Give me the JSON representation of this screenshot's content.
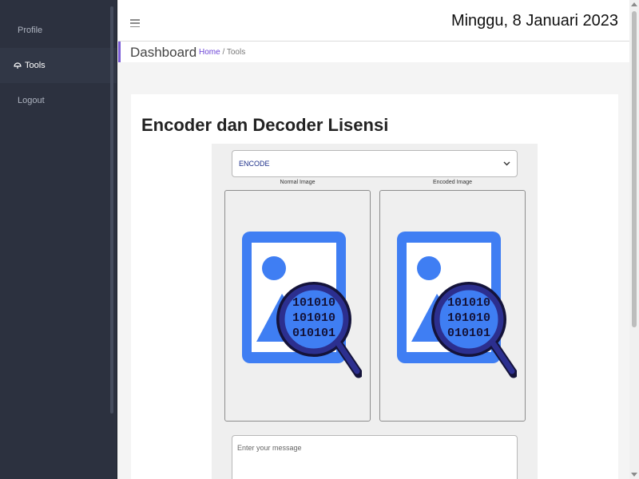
{
  "sidebar": {
    "items": [
      {
        "label": "Profile",
        "active": false
      },
      {
        "label": "Tools",
        "active": true
      },
      {
        "label": "Logout",
        "active": false
      }
    ]
  },
  "header": {
    "date": "Minggu, 8 Januari 2023",
    "page_title": "Dashboard",
    "breadcrumb": {
      "home": "Home",
      "separator": "/",
      "current": "Tools"
    }
  },
  "card": {
    "title": "Encoder dan Decoder Lisensi",
    "mode_select": {
      "selected": "ENCODE"
    },
    "normal_image_caption": "Normal Image",
    "encoded_image_caption": "Encoded Image",
    "image_icon_binary": [
      "101010",
      "101010",
      "010101"
    ],
    "message": {
      "placeholder": "Enter your message",
      "value": ""
    }
  },
  "colors": {
    "sidebar_bg": "#2c313f",
    "accent": "#7a5bd6",
    "icon_blue": "#3f7ef3",
    "lens_ring": "#2c2f8f"
  }
}
